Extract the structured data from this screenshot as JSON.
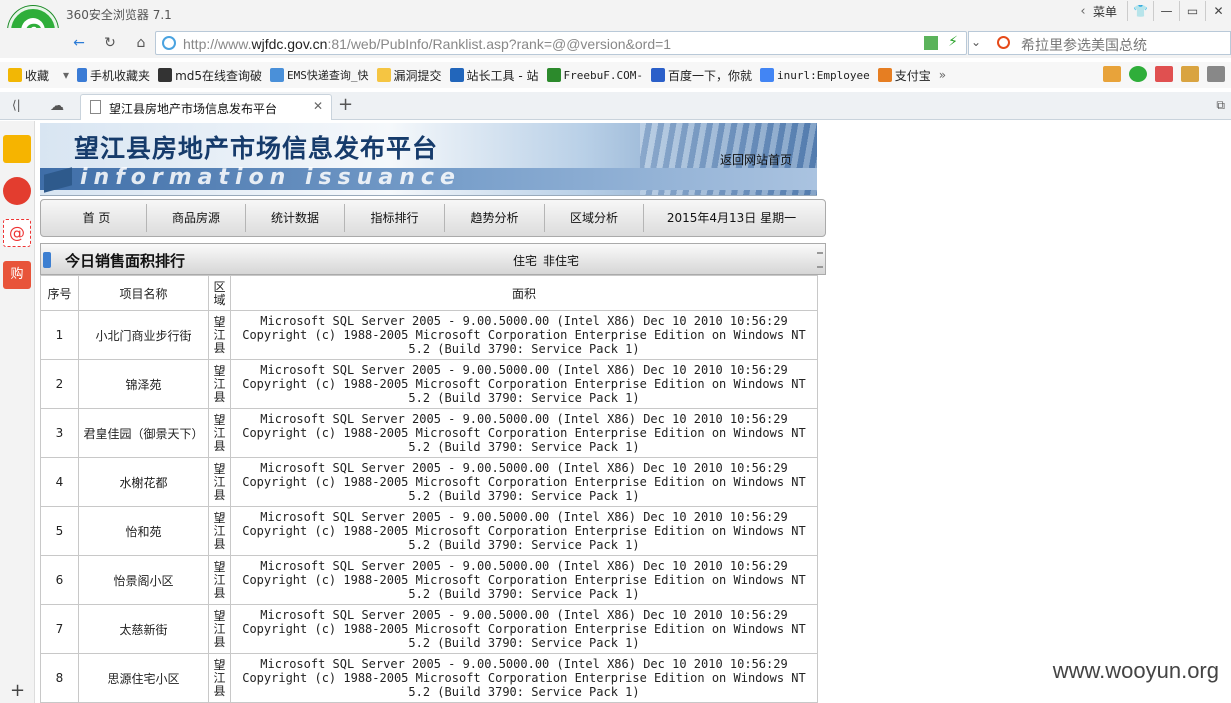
{
  "browser": {
    "app_title": "360安全浏览器 7.1",
    "menu_label": "菜单",
    "url_prefix": "http://www.",
    "url_domain": "wjfdc.gov.cn",
    "url_rest": ":81/web/PubInfo/Ranklist.asp?rank=@@version&ord=1",
    "search_text": "希拉里参选美国总统",
    "bookmarks": [
      "收藏",
      "手机收藏夹",
      "md5在线查询破",
      "EMS快递查询_快",
      "漏洞提交",
      "站长工具 - 站",
      "FreebuF.COM-",
      "百度一下，你就",
      "inurl:Employee",
      "支付宝"
    ],
    "bookmark_more": "»",
    "tab_title": "望江县房地产市场信息发布平台"
  },
  "site": {
    "title": "望江县房地产市场信息发布平台",
    "subtitle": "information issuance",
    "home_link": "返回网站首页",
    "nav": [
      "首 页",
      "商品房源",
      "统计数据",
      "指标排行",
      "趋势分析",
      "区域分析",
      "2015年4月13日  星期一"
    ],
    "section_title": "今日销售面积排行",
    "filter_options": [
      "住宅",
      "非住宅"
    ]
  },
  "table": {
    "headers": [
      "序号",
      "项目名称",
      "区域",
      "面积"
    ],
    "rows": [
      {
        "idx": "1",
        "name": "小北门商业步行街",
        "region": "望江县",
        "area": "Microsoft SQL Server 2005 - 9.00.5000.00 (Intel X86) Dec 10 2010 10:56:29 Copyright (c) 1988-2005 Microsoft Corporation Enterprise Edition on Windows NT 5.2 (Build 3790: Service Pack 1)"
      },
      {
        "idx": "2",
        "name": "锦泽苑",
        "region": "望江县",
        "area": "Microsoft SQL Server 2005 - 9.00.5000.00 (Intel X86) Dec 10 2010 10:56:29 Copyright (c) 1988-2005 Microsoft Corporation Enterprise Edition on Windows NT 5.2 (Build 3790: Service Pack 1)"
      },
      {
        "idx": "3",
        "name": "君皇佳园（御景天下）",
        "region": "望江县",
        "area": "Microsoft SQL Server 2005 - 9.00.5000.00 (Intel X86) Dec 10 2010 10:56:29 Copyright (c) 1988-2005 Microsoft Corporation Enterprise Edition on Windows NT 5.2 (Build 3790: Service Pack 1)"
      },
      {
        "idx": "4",
        "name": "水榭花都",
        "region": "望江县",
        "area": "Microsoft SQL Server 2005 - 9.00.5000.00 (Intel X86) Dec 10 2010 10:56:29 Copyright (c) 1988-2005 Microsoft Corporation Enterprise Edition on Windows NT 5.2 (Build 3790: Service Pack 1)"
      },
      {
        "idx": "5",
        "name": "怡和苑",
        "region": "望江县",
        "area": "Microsoft SQL Server 2005 - 9.00.5000.00 (Intel X86) Dec 10 2010 10:56:29 Copyright (c) 1988-2005 Microsoft Corporation Enterprise Edition on Windows NT 5.2 (Build 3790: Service Pack 1)"
      },
      {
        "idx": "6",
        "name": "怡景阁小区",
        "region": "望江县",
        "area": "Microsoft SQL Server 2005 - 9.00.5000.00 (Intel X86) Dec 10 2010 10:56:29 Copyright (c) 1988-2005 Microsoft Corporation Enterprise Edition on Windows NT 5.2 (Build 3790: Service Pack 1)"
      },
      {
        "idx": "7",
        "name": "太慈新街",
        "region": "望江县",
        "area": "Microsoft SQL Server 2005 - 9.00.5000.00 (Intel X86) Dec 10 2010 10:56:29 Copyright (c) 1988-2005 Microsoft Corporation Enterprise Edition on Windows NT 5.2 (Build 3790: Service Pack 1)"
      },
      {
        "idx": "8",
        "name": "思源住宅小区",
        "region": "望江县",
        "area": "Microsoft SQL Server 2005 - 9.00.5000.00 (Intel X86) Dec 10 2010 10:56:29 Copyright (c) 1988-2005 Microsoft Corporation Enterprise Edition on Windows NT 5.2 (Build 3790: Service Pack 1)"
      }
    ]
  },
  "watermark": "www.wooyun.org",
  "colors": {
    "brand_green": "#2fae3a",
    "banner_blue": "#163b6b",
    "section_marker": "#3d7fd1"
  }
}
